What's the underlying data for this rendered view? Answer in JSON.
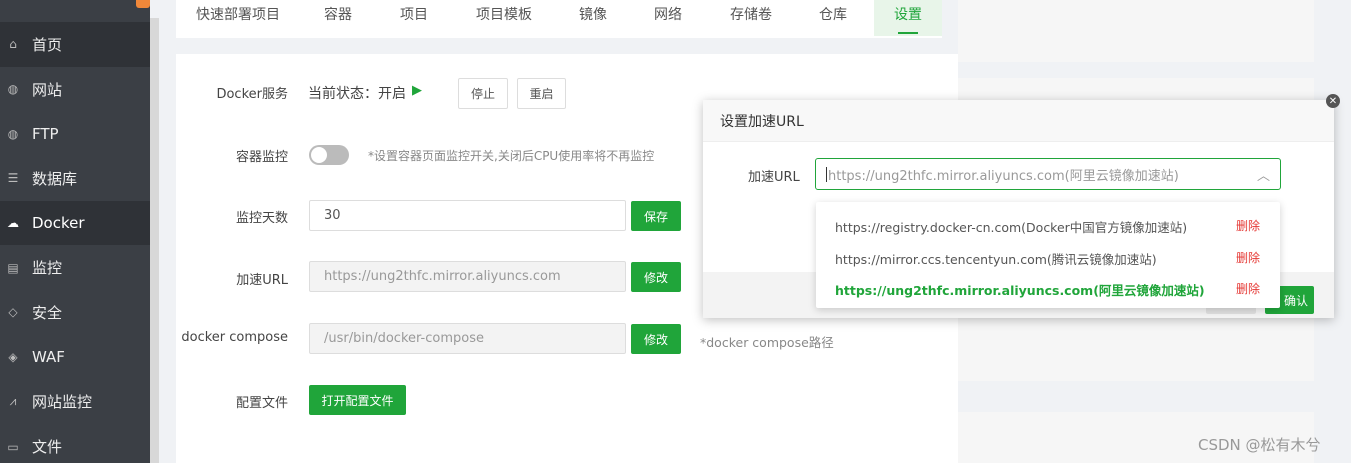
{
  "sidebar": {
    "items": [
      {
        "label": "首页",
        "icon": "home-icon",
        "glyph": "⌂"
      },
      {
        "label": "网站",
        "icon": "globe-icon",
        "glyph": "◍"
      },
      {
        "label": "FTP",
        "icon": "ftp-icon",
        "glyph": "◍"
      },
      {
        "label": "数据库",
        "icon": "database-icon",
        "glyph": "☰"
      },
      {
        "label": "Docker",
        "icon": "docker-icon",
        "glyph": "☁"
      },
      {
        "label": "监控",
        "icon": "monitor-icon",
        "glyph": "▤"
      },
      {
        "label": "安全",
        "icon": "shield-icon",
        "glyph": "◇"
      },
      {
        "label": "WAF",
        "icon": "waf-icon",
        "glyph": "◈"
      },
      {
        "label": "网站监控",
        "icon": "chart-icon",
        "glyph": "⩘"
      },
      {
        "label": "文件",
        "icon": "folder-icon",
        "glyph": "▭"
      }
    ],
    "active_index": 4
  },
  "tabs": [
    {
      "label": "快速部署项目"
    },
    {
      "label": "容器"
    },
    {
      "label": "项目"
    },
    {
      "label": "项目模板"
    },
    {
      "label": "镜像"
    },
    {
      "label": "网络"
    },
    {
      "label": "存储卷"
    },
    {
      "label": "仓库"
    },
    {
      "label": "设置"
    }
  ],
  "settings": {
    "docker_service": {
      "label": "Docker服务",
      "status": "当前状态：开启",
      "status_icon": "play-icon",
      "stop_label": "停止",
      "restart_label": "重启"
    },
    "container_monitor": {
      "label": "容器监控",
      "hint": "*设置容器页面监控开关,关闭后CPU使用率将不再监控",
      "enabled": false
    },
    "monitor_days": {
      "label": "监控天数",
      "value": "30",
      "save_label": "保存"
    },
    "mirror_url": {
      "label": "加速URL",
      "value": "https://ung2thfc.mirror.aliyuncs.com",
      "edit_label": "修改"
    },
    "compose": {
      "label": "docker compose",
      "value": "/usr/bin/docker-compose",
      "edit_label": "修改",
      "hint": "*docker compose路径"
    },
    "config_file": {
      "label": "配置文件",
      "open_label": "打开配置文件"
    }
  },
  "modal": {
    "title": "设置加速URL",
    "field_label": "加速URL",
    "placeholder": "https://ung2thfc.mirror.aliyuncs.com(阿里云镜像加速站)",
    "confirm_label": "确认",
    "options": [
      {
        "label": "https://registry.docker-cn.com(Docker中国官方镜像加速站)",
        "delete": "删除",
        "selected": false
      },
      {
        "label": "https://mirror.ccs.tencentyun.com(腾讯云镜像加速站)",
        "delete": "删除",
        "selected": false
      },
      {
        "label": "https://ung2thfc.mirror.aliyuncs.com(阿里云镜像加速站)",
        "delete": "删除",
        "selected": true
      }
    ]
  },
  "watermark": "CSDN @松有木兮",
  "colors": {
    "accent": "#20a53a",
    "danger": "#e53935",
    "sidebar": "#3b3f45"
  }
}
